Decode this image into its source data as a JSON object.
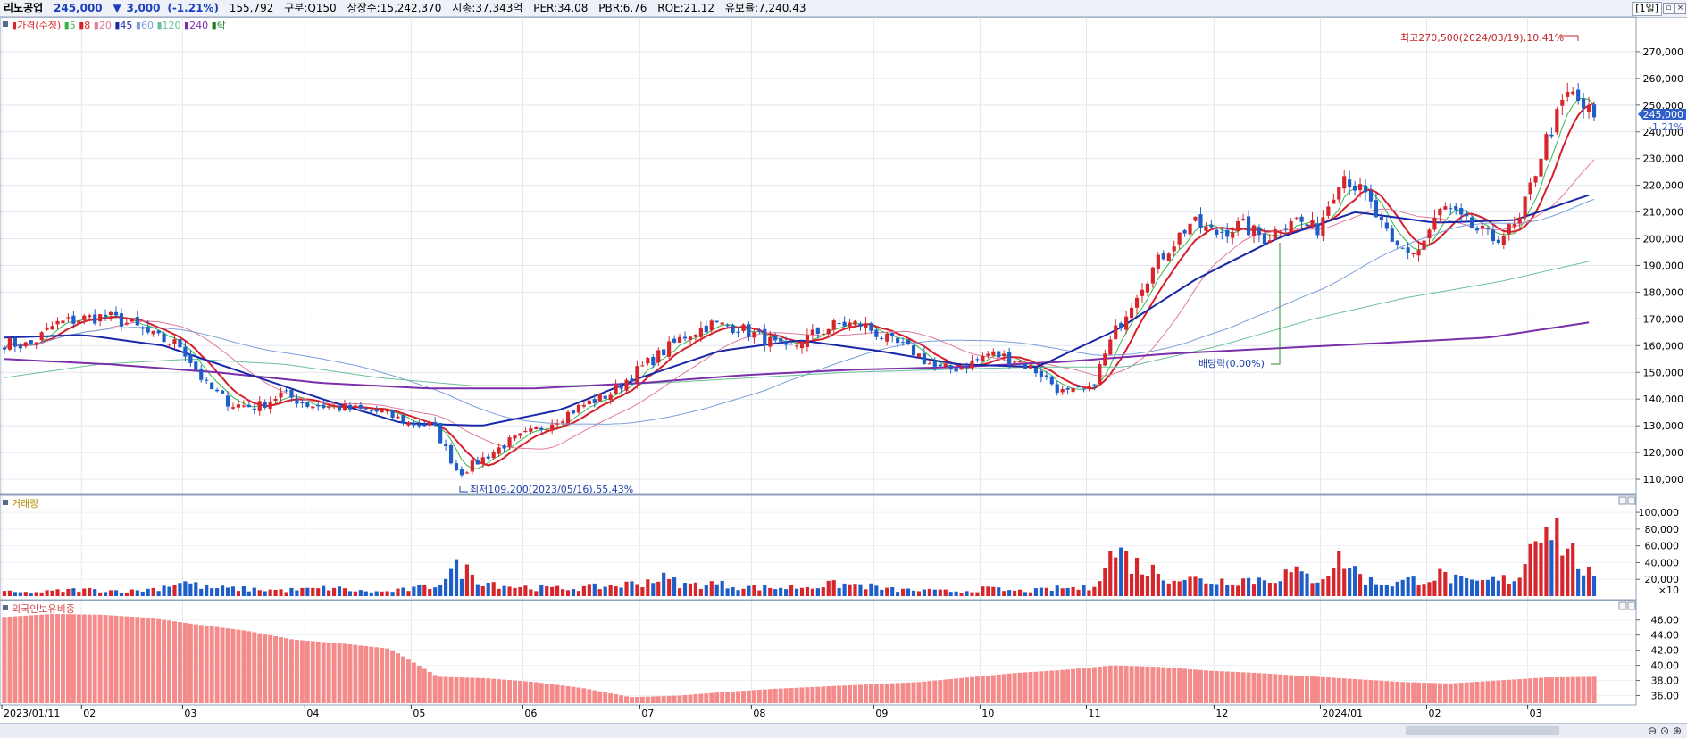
{
  "header": {
    "stock_name": "리노공업",
    "price": "245,000",
    "change_arrow": "▼",
    "change": "3,000",
    "change_pct": "(-1.21%)",
    "volume": "155,792",
    "market": "구분:Q150",
    "shares": "상장수:15,242,370",
    "market_cap": "시총:37,343억",
    "per": "PER:34.08",
    "pbr": "PBR:6.76",
    "roe": "ROE:21.12",
    "float": "유보율:7,240.43",
    "period": "[1일]"
  },
  "colors": {
    "up": "#d7262b",
    "down": "#1d5ec9",
    "ma5": "#38b54a",
    "ma8": "#d51f2a",
    "ma20": "#e07a9a",
    "ma45": "#1a28a8",
    "ma60": "#7b9ed8",
    "ma120": "#6cbf9a",
    "ma240": "#7b2fa8",
    "foreign": "#f58a8a"
  },
  "price_panel": {
    "legend": [
      {
        "label": "가격(수정)",
        "color": "#d7262b"
      },
      {
        "label": "5",
        "color": "#38b54a"
      },
      {
        "label": "8",
        "color": "#d51f2a"
      },
      {
        "label": "20",
        "color": "#e07a9a"
      },
      {
        "label": "45",
        "color": "#1a28a8"
      },
      {
        "label": "60",
        "color": "#7b9ed8"
      },
      {
        "label": "120",
        "color": "#6cbf9a"
      },
      {
        "label": "240",
        "color": "#7b2fa8"
      },
      {
        "label": "락",
        "color": "#1a7a1a"
      }
    ],
    "high_annotation": "최고270,500(2024/03/19),10.41%",
    "low_annotation": "최저109,200(2023/05/16),55.43%",
    "dividend_annotation": "배당락(0.00%)",
    "current_price_tag": "245,000",
    "current_pct_tag": "-1.21%"
  },
  "volume_panel": {
    "title": "거래량",
    "unit": "×10"
  },
  "foreign_panel": {
    "title": "외국인보유비중"
  },
  "date_labels": [
    "2023/01/11",
    "02",
    "03",
    "04",
    "05",
    "06",
    "07",
    "08",
    "09",
    "10",
    "11",
    "12",
    "2024/01",
    "02",
    "03"
  ],
  "chart_data": [
    {
      "type": "candlestick",
      "title": "가격(수정)",
      "x_range": [
        "2023/01/11",
        "2024/03/26"
      ],
      "ylim": [
        105000,
        282000
      ],
      "y_ticks": [
        110000,
        120000,
        130000,
        140000,
        150000,
        160000,
        170000,
        180000,
        190000,
        200000,
        210000,
        220000,
        230000,
        240000,
        250000,
        260000,
        270000
      ],
      "y_tick_labels": [
        "110,000",
        "120,000",
        "130,000",
        "140,000",
        "150,000",
        "160,000",
        "170,000",
        "180,000",
        "190,000",
        "200,000",
        "210,000",
        "220,000",
        "230,000",
        "240,000",
        "250,000",
        "260,000",
        "270,000"
      ],
      "closes_weekly": [
        161000,
        160000,
        168000,
        170000,
        171000,
        168000,
        163000,
        160000,
        145000,
        138000,
        137000,
        142000,
        138000,
        137000,
        136000,
        135000,
        131000,
        130000,
        112000,
        118000,
        124000,
        128000,
        133000,
        138000,
        142000,
        150000,
        157000,
        164000,
        168000,
        167000,
        163000,
        158000,
        164000,
        168000,
        168000,
        162000,
        158000,
        151000,
        152000,
        157000,
        155000,
        150000,
        142000,
        143000,
        165000,
        182000,
        195000,
        206000,
        202000,
        205000,
        200000,
        208000,
        203000,
        225000,
        215000,
        197000,
        195000,
        212000,
        205000,
        200000,
        205000,
        235000,
        255000,
        245000
      ],
      "series": [
        {
          "name": "5",
          "values": []
        },
        {
          "name": "8",
          "values": []
        },
        {
          "name": "20",
          "values": []
        },
        {
          "name": "45",
          "values": [
            163000,
            164000,
            160000,
            150000,
            140000,
            131000,
            130000,
            136000,
            148000,
            158000,
            162000,
            158000,
            153000,
            152000,
            166000,
            185000,
            200000,
            210000,
            206000,
            207000,
            217000
          ]
        },
        {
          "name": "60",
          "values": []
        },
        {
          "name": "120",
          "values": [
            148000,
            153000,
            155000,
            153000,
            148000,
            145000,
            145000,
            146000,
            148000,
            150000,
            151000,
            152000,
            152000,
            160000,
            170000,
            178000,
            184000,
            192000
          ]
        },
        {
          "name": "240",
          "values": [
            155000,
            153000,
            150000,
            146000,
            144000,
            144000,
            146000,
            149000,
            151000,
            152000,
            154000,
            157000,
            159000,
            161000,
            163000,
            169000
          ]
        }
      ],
      "annotations": [
        {
          "text": "최고270,500(2024/03/19),10.41%",
          "value": 270500,
          "date": "2024/03/19"
        },
        {
          "text": "최저109,200(2023/05/16),55.43%",
          "value": 109200,
          "date": "2023/05/16"
        },
        {
          "text": "배당락(0.00%)",
          "date": "2023/12/27"
        }
      ]
    },
    {
      "type": "bar",
      "title": "거래량",
      "unit": "×10",
      "ylim": [
        0,
        115000
      ],
      "y_ticks": [
        20000,
        40000,
        60000,
        80000,
        100000
      ],
      "y_tick_labels": [
        "20,000",
        "40,000",
        "60,000",
        "80,000",
        "100,000"
      ],
      "values_weekly": [
        5000,
        4000,
        6000,
        8000,
        7000,
        6000,
        9000,
        18000,
        10000,
        9000,
        8000,
        7000,
        8000,
        10000,
        6000,
        5000,
        8000,
        12000,
        35000,
        18000,
        12000,
        10000,
        9000,
        10000,
        12000,
        15000,
        22000,
        13000,
        15000,
        12000,
        10000,
        10000,
        12000,
        14000,
        13000,
        8000,
        7000,
        6000,
        6000,
        9000,
        6000,
        7000,
        10000,
        9000,
        55000,
        35000,
        25000,
        20000,
        18000,
        20000,
        20000,
        28000,
        20000,
        45000,
        18000,
        15000,
        20000,
        25000,
        15000,
        18000,
        22000,
        105000,
        55000,
        18000
      ]
    },
    {
      "type": "bar",
      "title": "외국인보유비중",
      "ylim": [
        35.0,
        47.5
      ],
      "y_ticks": [
        36.0,
        38.0,
        40.0,
        42.0,
        44.0,
        46.0
      ],
      "y_tick_labels": [
        "36.00",
        "38.00",
        "40.00",
        "42.00",
        "44.00",
        "46.00"
      ],
      "values_monthly": [
        46.4,
        46.8,
        46.7,
        46.3,
        45.4,
        44.6,
        43.4,
        42.9,
        42.2,
        38.5,
        38.3,
        37.8,
        37.0,
        35.8,
        36.0,
        36.5,
        36.9,
        37.2,
        37.5,
        37.8,
        38.4,
        39.0,
        39.4,
        40.0,
        39.8,
        39.3,
        39.0,
        38.6,
        38.2,
        37.8,
        37.6,
        38.0,
        38.4,
        38.5
      ]
    }
  ]
}
